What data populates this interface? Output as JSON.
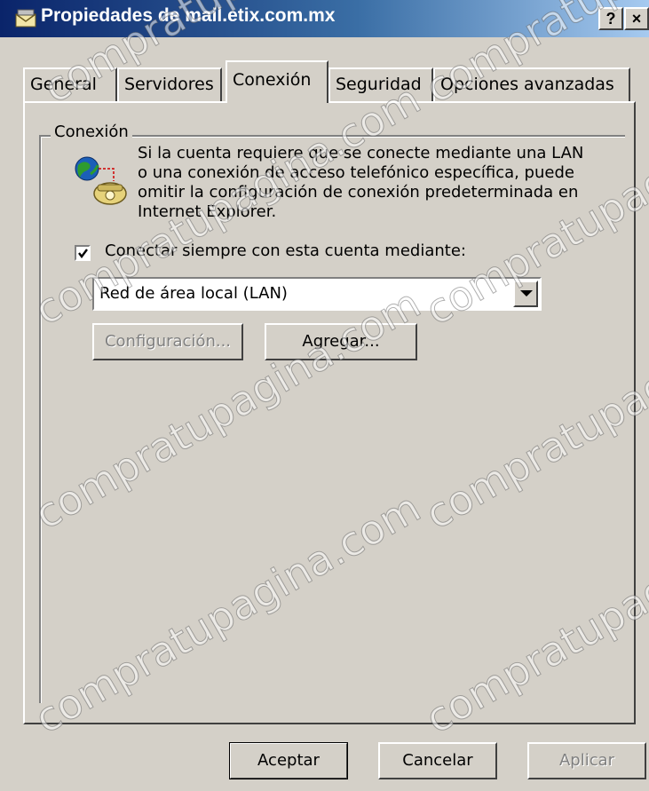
{
  "window": {
    "title": "Propiedades de mail.etix.com.mx",
    "help_label": "?",
    "close_label": "×"
  },
  "tabs": [
    {
      "label": "General",
      "active": false
    },
    {
      "label": "Servidores",
      "active": false
    },
    {
      "label": "Conexión",
      "active": true
    },
    {
      "label": "Seguridad",
      "active": false
    },
    {
      "label": "Opciones avanzadas",
      "active": false
    }
  ],
  "connection": {
    "group_label": "Conexión",
    "description": "Si la cuenta requiere que se conecte mediante una LAN\no una conexión de acceso telefónico específica, puede\nomitir la configuración de conexión predeterminada en\nInternet Explorer.",
    "checkbox_label": "Conectar siempre con esta cuenta mediante:",
    "checkbox_checked": true,
    "selected_connection": "Red de área local (LAN)",
    "config_button": "Configuración...",
    "add_button": "Agregar..."
  },
  "footer": {
    "ok": "Aceptar",
    "cancel": "Cancelar",
    "apply": "Aplicar"
  },
  "watermark": "compratupagina.com",
  "colors": {
    "face": "#d4d0c8",
    "title_start": "#0a246a",
    "title_end": "#a6caf0",
    "disabled_text": "#808080"
  }
}
